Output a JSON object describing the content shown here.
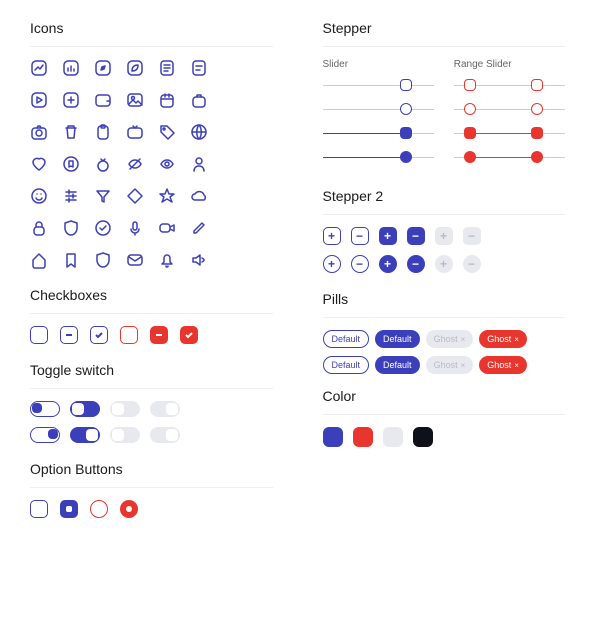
{
  "sections": {
    "icons": "Icons",
    "checkboxes": "Checkboxes",
    "toggle": "Toggle switch",
    "option": "Option Buttons",
    "stepper": "Stepper",
    "slider": "Slider",
    "range_slider": "Range Slider",
    "stepper2": "Stepper 2",
    "pills": "Pills",
    "color": "Color"
  },
  "pills": {
    "default": "Default",
    "ghost": "Ghost",
    "close": "×"
  },
  "colors": {
    "blue": "#3b3fba",
    "red": "#e8362e",
    "gray": "#e8e9ef",
    "black": "#0f111a"
  },
  "stepper2": {
    "plus": "+",
    "minus": "−"
  }
}
